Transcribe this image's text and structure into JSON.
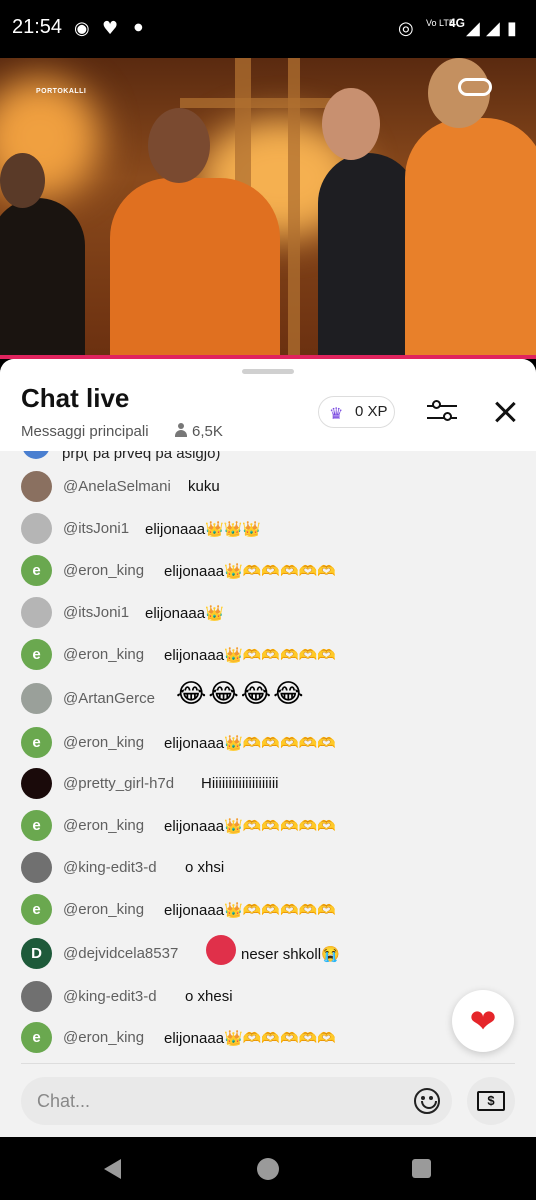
{
  "status_bar": {
    "time": "21:54",
    "lte_label": "Vo LTE",
    "network": "4G"
  },
  "video": {
    "channel_logo": "PORTOKALLI"
  },
  "chat": {
    "title": "Chat live",
    "filter_label": "Messaggi principali",
    "viewer_count": "6,5K",
    "xp_label": "0 XP",
    "partial_message": "prp( pa prveq pa asigjo)",
    "messages": [
      {
        "user": "@AnelaSelmani",
        "text": "kuku",
        "avatar_letter": "",
        "avatar_color": "#8a7060"
      },
      {
        "user": "@itsJoni1",
        "text": "elijonaaa👑👑👑",
        "avatar_letter": "",
        "avatar_color": "#b5b5b5"
      },
      {
        "user": "@eron_king",
        "text": "elijonaaa👑🫶🫶🫶🫶🫶",
        "avatar_letter": "e",
        "avatar_color": "#6aa84f"
      },
      {
        "user": "@itsJoni1",
        "text": "elijonaaa👑",
        "avatar_letter": "",
        "avatar_color": "#b5b5b5"
      },
      {
        "user": "@eron_king",
        "text": "elijonaaa👑🫶🫶🫶🫶🫶",
        "avatar_letter": "e",
        "avatar_color": "#6aa84f"
      },
      {
        "user": "@ArtanGerce",
        "text": "😂😂😂😂",
        "avatar_letter": "",
        "avatar_color": "#9aa09a"
      },
      {
        "user": "@eron_king",
        "text": "elijonaaa👑🫶🫶🫶🫶🫶",
        "avatar_letter": "e",
        "avatar_color": "#6aa84f"
      },
      {
        "user": "@pretty_girl-h7d",
        "text": "Hiiiiiiiiiiiiiiiiiiii",
        "avatar_letter": "",
        "avatar_color": "#1a0a0a"
      },
      {
        "user": "@eron_king",
        "text": "elijonaaa👑🫶🫶🫶🫶🫶",
        "avatar_letter": "e",
        "avatar_color": "#6aa84f"
      },
      {
        "user": "@king-edit3-d",
        "text": "o xhsi",
        "avatar_letter": "",
        "avatar_color": "#707070"
      },
      {
        "user": "@eron_king",
        "text": "elijonaaa👑🫶🫶🫶🫶🫶",
        "avatar_letter": "e",
        "avatar_color": "#6aa84f"
      },
      {
        "user": "@dejvidcela8537",
        "text": "neser shkoll😭",
        "avatar_letter": "D",
        "avatar_color": "#1e5a3a"
      },
      {
        "user": "@king-edit3-d",
        "text": "o xhesi",
        "avatar_letter": "",
        "avatar_color": "#707070"
      },
      {
        "user": "@eron_king",
        "text": "elijonaaa👑🫶🫶🫶🫶🫶",
        "avatar_letter": "e",
        "avatar_color": "#6aa84f"
      }
    ],
    "input_placeholder": "Chat...",
    "superchat_symbol": "$",
    "heart_symbol": "❤"
  },
  "colors": {
    "accent_bar": "#e0245e",
    "crown": "#7a4be0",
    "heart": "#e5252a"
  }
}
